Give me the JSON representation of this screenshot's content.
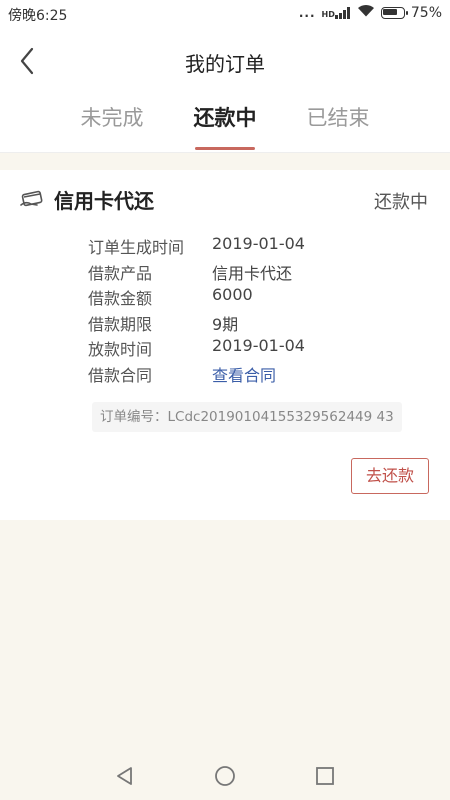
{
  "status_bar": {
    "time": "傍晚6:25",
    "dots": "...",
    "network": "HD",
    "battery_percent": "75%",
    "battery_level": 0.75
  },
  "header": {
    "title": "我的订单",
    "back_icon": "chevron-left-icon"
  },
  "tabs": [
    {
      "label": "未完成",
      "active": false
    },
    {
      "label": "还款中",
      "active": true
    },
    {
      "label": "已结束",
      "active": false
    }
  ],
  "order": {
    "icon": "credit-card-hand-icon",
    "product_title": "信用卡代还",
    "status": "还款中",
    "details": [
      {
        "label": "订单生成时间",
        "value": "2019-01-04"
      },
      {
        "label": "借款产品",
        "value": "信用卡代还"
      },
      {
        "label": "借款金额",
        "value": "6000"
      },
      {
        "label": "借款期限",
        "value": "9期"
      },
      {
        "label": "放款时间",
        "value": "2019-01-04"
      },
      {
        "label": "借款合同",
        "value": "查看合同"
      }
    ],
    "order_number": "订单编号：LCdc20190104155329562449 43",
    "repay_button": "去还款"
  },
  "colors": {
    "accent": "#c8685e",
    "link": "#3b5ea8",
    "background": "#f9f6ee"
  },
  "system_nav": {
    "back_icon": "triangle-back-icon",
    "home_icon": "circle-home-icon",
    "recent_icon": "square-recent-icon"
  }
}
